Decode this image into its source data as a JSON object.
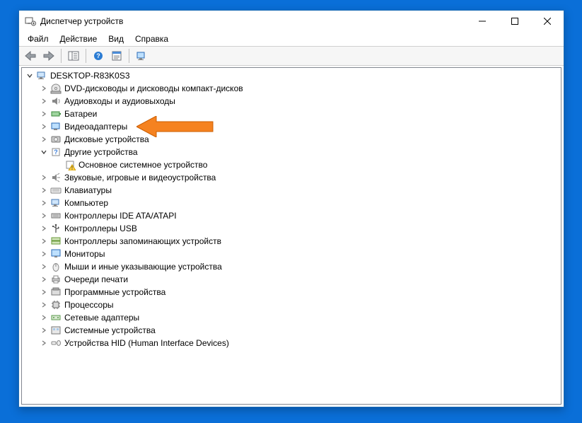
{
  "window": {
    "title": "Диспетчер устройств"
  },
  "menu": {
    "file": "Файл",
    "action": "Действие",
    "view": "Вид",
    "help": "Справка"
  },
  "tree": {
    "root": "DESKTOP-R83K0S3",
    "items": [
      {
        "label": "DVD-дисководы и дисководы компакт-дисков",
        "exp": ">"
      },
      {
        "label": "Аудиовходы и аудиовыходы",
        "exp": ">"
      },
      {
        "label": "Батареи",
        "exp": ">"
      },
      {
        "label": "Видеоадаптеры",
        "exp": ">"
      },
      {
        "label": "Дисковые устройства",
        "exp": ">"
      },
      {
        "label": "Другие устройства",
        "exp": "v",
        "children": [
          {
            "label": "Основное системное устройство"
          }
        ]
      },
      {
        "label": "Звуковые, игровые и видеоустройства",
        "exp": ">"
      },
      {
        "label": "Клавиатуры",
        "exp": ">"
      },
      {
        "label": "Компьютер",
        "exp": ">"
      },
      {
        "label": "Контроллеры IDE ATA/ATAPI",
        "exp": ">"
      },
      {
        "label": "Контроллеры USB",
        "exp": ">"
      },
      {
        "label": "Контроллеры запоминающих устройств",
        "exp": ">"
      },
      {
        "label": "Мониторы",
        "exp": ">"
      },
      {
        "label": "Мыши и иные указывающие устройства",
        "exp": ">"
      },
      {
        "label": "Очереди печати",
        "exp": ">"
      },
      {
        "label": "Программные устройства",
        "exp": ">"
      },
      {
        "label": "Процессоры",
        "exp": ">"
      },
      {
        "label": "Сетевые адаптеры",
        "exp": ">"
      },
      {
        "label": "Системные устройства",
        "exp": ">"
      },
      {
        "label": "Устройства HID (Human Interface Devices)",
        "exp": ">"
      }
    ]
  }
}
